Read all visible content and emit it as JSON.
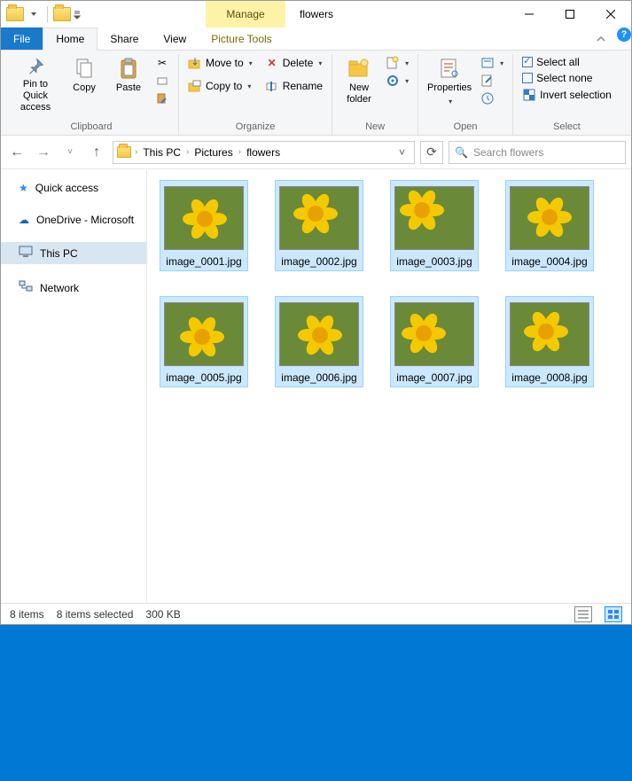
{
  "window": {
    "title": "flowers",
    "contextual_tab": "Manage",
    "contextual_sub": "Picture Tools"
  },
  "tabs": {
    "file": "File",
    "home": "Home",
    "share": "Share",
    "view": "View"
  },
  "ribbon": {
    "clipboard": {
      "label": "Clipboard",
      "pin": "Pin to Quick access",
      "copy": "Copy",
      "paste": "Paste"
    },
    "organize": {
      "label": "Organize",
      "moveto": "Move to",
      "copyto": "Copy to",
      "delete": "Delete",
      "rename": "Rename"
    },
    "new": {
      "label": "New",
      "newfolder": "New folder"
    },
    "open": {
      "label": "Open",
      "properties": "Properties"
    },
    "select": {
      "label": "Select",
      "all": "Select all",
      "none": "Select none",
      "invert": "Invert selection"
    }
  },
  "breadcrumb": {
    "p1": "This PC",
    "p2": "Pictures",
    "p3": "flowers"
  },
  "search": {
    "placeholder": "Search flowers"
  },
  "nav": {
    "quick": "Quick access",
    "onedrive": "OneDrive - Microsoft",
    "thispc": "This PC",
    "network": "Network"
  },
  "files": [
    {
      "name": "image_0001.jpg"
    },
    {
      "name": "image_0002.jpg"
    },
    {
      "name": "image_0003.jpg"
    },
    {
      "name": "image_0004.jpg"
    },
    {
      "name": "image_0005.jpg"
    },
    {
      "name": "image_0006.jpg"
    },
    {
      "name": "image_0007.jpg"
    },
    {
      "name": "image_0008.jpg"
    }
  ],
  "status": {
    "count": "8 items",
    "selected": "8 items selected",
    "size": "300 KB"
  }
}
